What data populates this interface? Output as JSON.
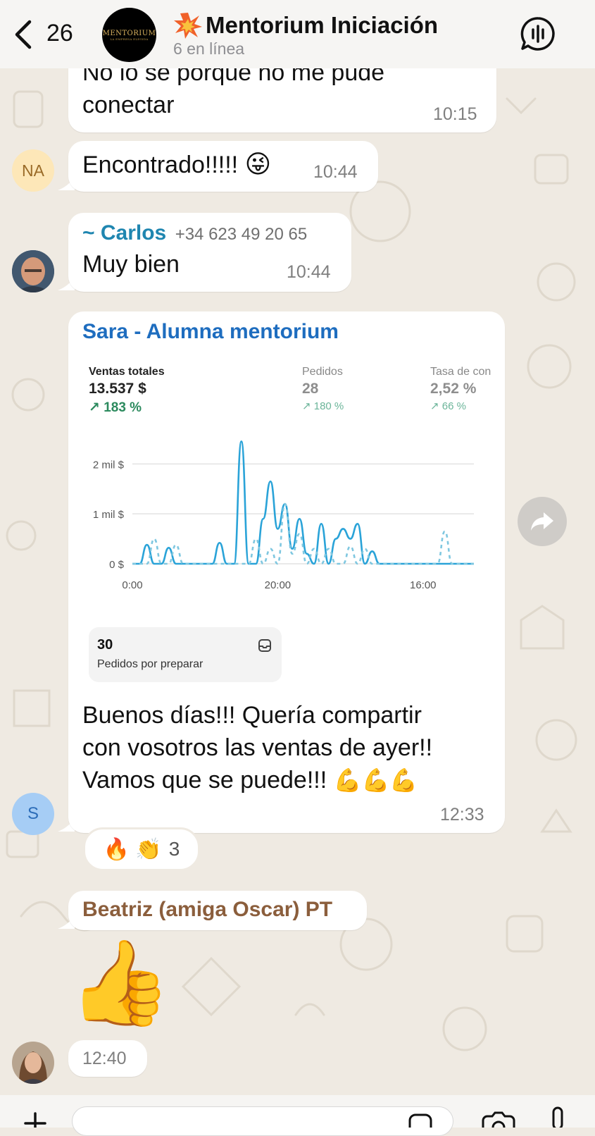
{
  "header": {
    "unread_count": "26",
    "avatar_logo": "MENTORIUM",
    "avatar_logo_sub": "LA EMPRESA ELEGIDA",
    "title": "Mentorium Iniciación",
    "subtitle": "6 en línea"
  },
  "messages": {
    "m1": {
      "text_line1": "No lo se porque no me pude",
      "text_line2": "conectar",
      "time": "10:15"
    },
    "m2": {
      "avatar_initials": "NA",
      "text": "Encontrado!!!!! ",
      "emoji": "😜",
      "time": "10:44"
    },
    "m3": {
      "sender": "~ Carlos",
      "phone": "+34 623 49 20 65",
      "text": "Muy bien",
      "time": "10:44"
    },
    "m4": {
      "sender": "Sara - Alumna mentorium",
      "avatar_initials": "S",
      "text_line1": "Buenos días!!! Quería compartir",
      "text_line2": "con vosotros las ventas de ayer!!",
      "text_line3": "Vamos que se puede!!! ",
      "emoji": "💪💪💪",
      "time": "12:33",
      "reactions": {
        "emojis": "🔥 👏",
        "count": "3"
      }
    },
    "m5": {
      "sender": "Beatriz (amiga Oscar) PT",
      "emoji": "👍",
      "time": "12:40"
    }
  },
  "image": {
    "stats": [
      {
        "label": "Ventas totales",
        "value": "13.537 $",
        "delta": "↗ 183 %"
      },
      {
        "label": "Pedidos",
        "value": "28",
        "delta": "↗ 180 %"
      },
      {
        "label": "Tasa de con",
        "value": "2,52 %",
        "delta": "↗ 66 %"
      }
    ],
    "pending": {
      "count": "30",
      "label": "Pedidos por preparar"
    }
  },
  "chart_data": {
    "type": "line",
    "title": "",
    "xlabel": "",
    "ylabel": "",
    "y_tick_labels": [
      "0 $",
      "1 mil $",
      "2 mil $"
    ],
    "y_ticks": [
      0,
      1000,
      2000
    ],
    "ylim": [
      0,
      2400
    ],
    "x_tick_labels": [
      "0:00",
      "20:00",
      "16:00"
    ],
    "x_tick_at": [
      0,
      20,
      40
    ],
    "xlim": [
      0,
      47
    ],
    "grid": true,
    "legend": "none",
    "colors": {
      "current": "#2aa3d8",
      "previous": "#7fc7e0"
    },
    "series": [
      {
        "style": "solid",
        "x": [
          0,
          1,
          2,
          3,
          4,
          5,
          6,
          7,
          8,
          9,
          10,
          11,
          12,
          13,
          14,
          15,
          16,
          17,
          18,
          19,
          20,
          21,
          22,
          23,
          24,
          25,
          26,
          27,
          28,
          29,
          30,
          31,
          32,
          33,
          34,
          35,
          36,
          37,
          38,
          39,
          40,
          41,
          42,
          43,
          44,
          45,
          46,
          47
        ],
        "values": [
          0,
          0,
          380,
          0,
          0,
          320,
          0,
          0,
          0,
          0,
          0,
          0,
          420,
          0,
          0,
          2450,
          0,
          0,
          900,
          1650,
          700,
          1200,
          300,
          900,
          200,
          0,
          800,
          0,
          500,
          700,
          500,
          800,
          0,
          250,
          0,
          0,
          0,
          0,
          0,
          0,
          0,
          0,
          0,
          0,
          0,
          0,
          0,
          0
        ]
      },
      {
        "style": "dashed",
        "x": [
          0,
          1,
          2,
          3,
          4,
          5,
          6,
          7,
          8,
          9,
          10,
          11,
          12,
          13,
          14,
          15,
          16,
          17,
          18,
          19,
          20,
          21,
          22,
          23,
          24,
          25,
          26,
          27,
          28,
          29,
          30,
          31,
          32,
          33,
          34,
          35,
          36,
          37,
          38,
          39,
          40,
          41,
          42,
          43,
          44,
          45,
          46,
          47
        ],
        "values": [
          0,
          0,
          0,
          500,
          0,
          0,
          380,
          0,
          0,
          0,
          0,
          0,
          0,
          0,
          0,
          0,
          0,
          500,
          0,
          300,
          0,
          1200,
          200,
          600,
          0,
          300,
          0,
          300,
          0,
          0,
          350,
          0,
          300,
          0,
          0,
          0,
          0,
          0,
          0,
          0,
          0,
          0,
          0,
          650,
          0,
          0,
          0,
          0
        ]
      }
    ]
  }
}
